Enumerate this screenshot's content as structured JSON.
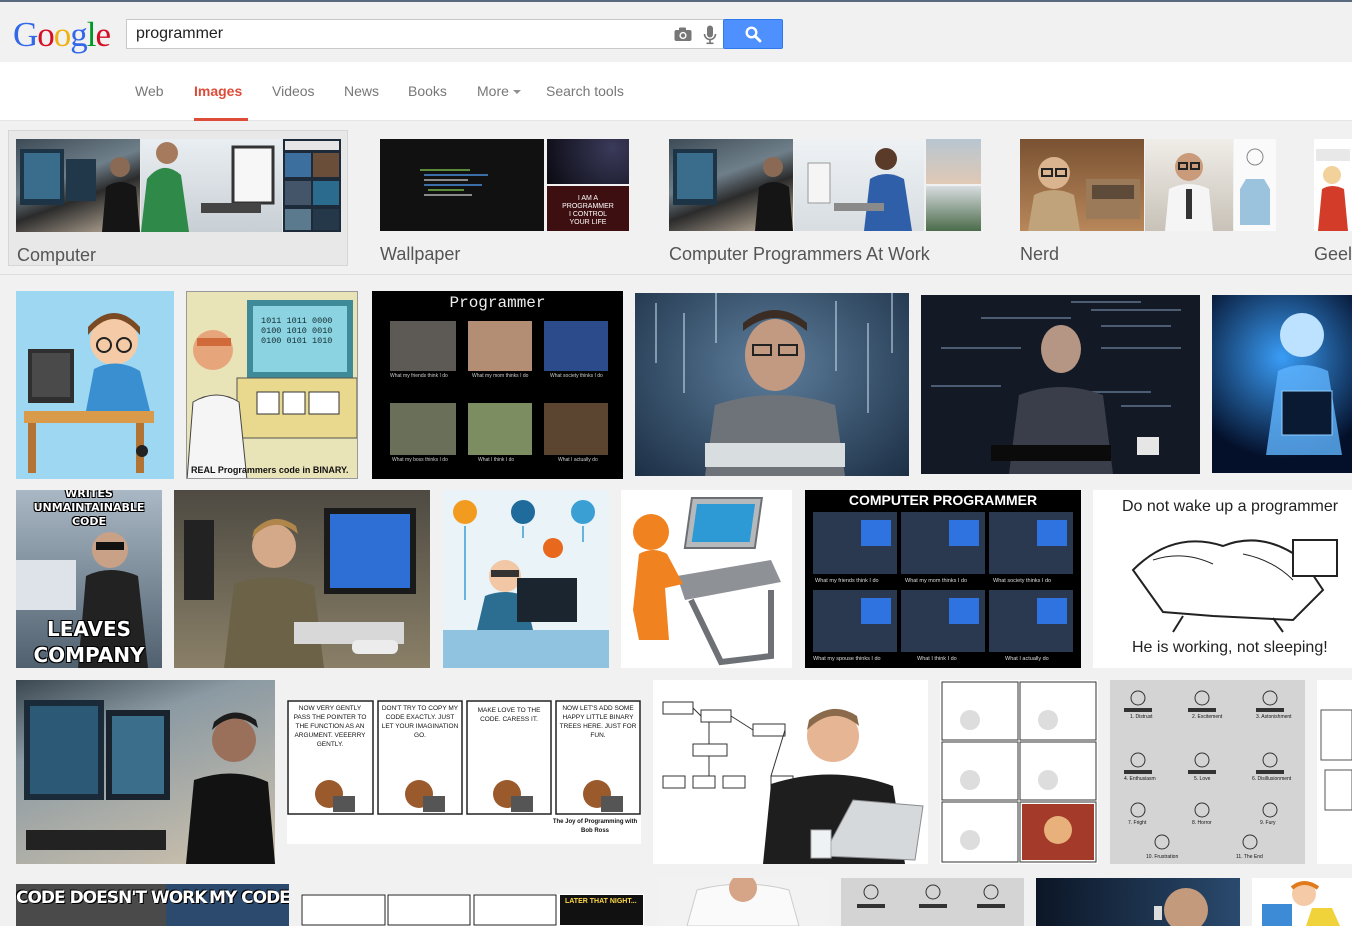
{
  "logo": {
    "letters": [
      "G",
      "o",
      "o",
      "g",
      "l",
      "e"
    ]
  },
  "search": {
    "query": "programmer"
  },
  "icons": {
    "camera": "camera-icon",
    "mic": "microphone-icon",
    "search": "magnifier-icon"
  },
  "tabs": [
    {
      "label": "Web"
    },
    {
      "label": "Images",
      "active": true
    },
    {
      "label": "Videos"
    },
    {
      "label": "News"
    },
    {
      "label": "Books"
    },
    {
      "label": "More"
    },
    {
      "label": "Search tools"
    }
  ],
  "related": [
    {
      "label": "Computer",
      "selected": true
    },
    {
      "label": "Wallpaper"
    },
    {
      "label": "Computer Programmers At Work"
    },
    {
      "label": "Nerd"
    },
    {
      "label": "Geel"
    }
  ],
  "image_text": {
    "binary_caption": "REAL Programmers code in BINARY.",
    "binary_digits": "1011 1011 0000 0100 1010 0010 0100 0101 1010",
    "programmer_meme_title": "Programmer",
    "programmer_meme_subs": [
      "What my friends think I do",
      "What my mom thinks I do",
      "What society thinks I do",
      "What my boss thinks I do",
      "What I think I do",
      "What I actually do"
    ],
    "wallpaper_text": [
      "I AM A",
      "PROGRAMMER",
      "I CONTROL",
      "YOUR LIFE"
    ],
    "unmaintainable_top": "WRITES UNMAINTAINABLE CODE",
    "unmaintainable_bottom": "LEAVES COMPANY",
    "computer_programmer_title": "COMPUTER PROGRAMMER",
    "cp_subs": [
      "What my friends think I do",
      "What my mom thinks I do",
      "What society thinks I do",
      "What my spouse thinks I do",
      "What I think I do",
      "What I actually do"
    ],
    "wake_top": "Do not wake up a programmer",
    "wake_bottom": "He is working, not sleeping!",
    "bob_panels": [
      "NOW VERY GENTLY PASS THE POINTER TO THE FUNCTION AS AN ARGUMENT. VEEERRY GENTLY.",
      "DON'T TRY TO COPY MY CODE EXACTLY. JUST LET YOUR IMAGINATION GO.",
      "MAKE LOVE TO THE CODE. CARESS IT.",
      "NOW LET'S ADD SOME HAPPY LITTLE BINARY TREES HERE. JUST FOR FUN."
    ],
    "bob_caption": "The Joy of Programming with Bob Ross",
    "code_doesnt_work": "CODE DOESN'T WORK",
    "my_code_w": "MY CODE W",
    "later_that_night": "LATER THAT NIGHT...",
    "comic_numbers": [
      "1. Distrust",
      "2. Excitement",
      "3. Astonishment",
      "4. Enthusiasm",
      "5. Love",
      "6. Disillusionment",
      "7. Fright",
      "8. Horror",
      "9. Fury",
      "10. Frustration",
      "11. The End"
    ]
  }
}
